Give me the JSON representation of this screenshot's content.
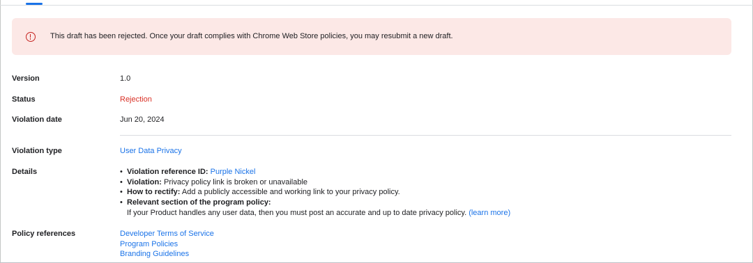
{
  "banner": {
    "text": "This draft has been rejected. Once your draft complies with Chrome Web Store policies, you may resubmit a new draft.",
    "icon": "error-icon",
    "color": "#c5221f",
    "background": "#fce8e6"
  },
  "fields": {
    "version": {
      "label": "Version",
      "value": "1.0"
    },
    "status": {
      "label": "Status",
      "value": "Rejection",
      "color": "#d93025"
    },
    "violation_date": {
      "label": "Violation date",
      "value": "Jun 20, 2024"
    },
    "violation_type": {
      "label": "Violation type",
      "value": "User Data Privacy"
    },
    "details": {
      "label": "Details",
      "reference_id_label": "Violation reference ID:",
      "reference_id_value": "Purple Nickel",
      "violation_label": "Violation:",
      "violation_value": "Privacy policy link is broken or unavailable",
      "rectify_label": "How to rectify:",
      "rectify_value": "Add a publicly accessible and working link to your privacy policy.",
      "section_label": "Relevant section of the program policy:",
      "section_text": "If your Product handles any user data, then you must post an accurate and up to date privacy policy.",
      "learn_more": "(learn more)"
    },
    "policy_references": {
      "label": "Policy references",
      "links": [
        "Developer Terms of Service",
        "Program Policies",
        "Branding Guidelines"
      ]
    }
  },
  "colors": {
    "accent": "#1a73e8",
    "error": "#d93025"
  }
}
